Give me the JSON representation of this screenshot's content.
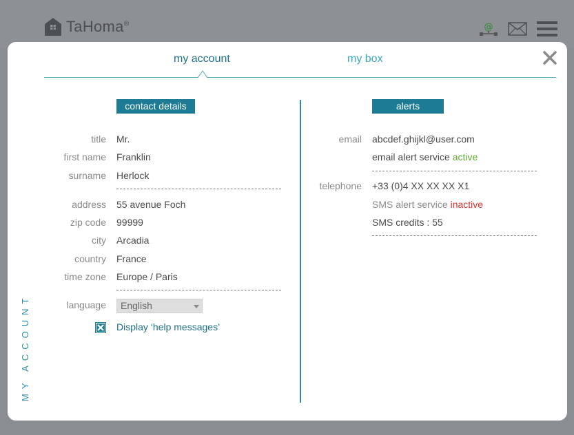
{
  "app": {
    "brand": "TaHoma",
    "brand_mark": "®"
  },
  "tabs": [
    {
      "label": "my account",
      "active": true
    },
    {
      "label": "my box",
      "active": false
    }
  ],
  "vertical_label": "MY ACCOUNT",
  "contact": {
    "title_badge": "contact details",
    "fields": [
      {
        "label": "title",
        "value": "Mr."
      },
      {
        "label": "first name",
        "value": "Franklin"
      },
      {
        "label": "surname",
        "value": "Herlock"
      },
      {
        "label": "address",
        "value": "55 avenue Foch"
      },
      {
        "label": "zip code",
        "value": "99999"
      },
      {
        "label": "city",
        "value": "Arcadia"
      },
      {
        "label": "country",
        "value": "France"
      },
      {
        "label": "time zone",
        "value": "Europe / Paris"
      }
    ],
    "language_label": "language",
    "language_value": "English",
    "help_checkbox_label": "Display ‘help messages’",
    "help_checked": true
  },
  "alerts": {
    "title_badge": "alerts",
    "email_label": "email",
    "email_value": "abcdef.ghijkl@user.com",
    "email_service_text": "email alert service",
    "email_service_status": "active",
    "telephone_label": "telephone",
    "telephone_value": "+33 (0)4 XX XX XX X1",
    "sms_service_text": "SMS alert service",
    "sms_service_status": "inactive",
    "sms_credits": "SMS credits : 55"
  },
  "colors": {
    "accent": "#1e7b95",
    "tab_inactive": "#3aa6bd",
    "active_status": "#5fae32",
    "inactive_status": "#d2352f"
  }
}
